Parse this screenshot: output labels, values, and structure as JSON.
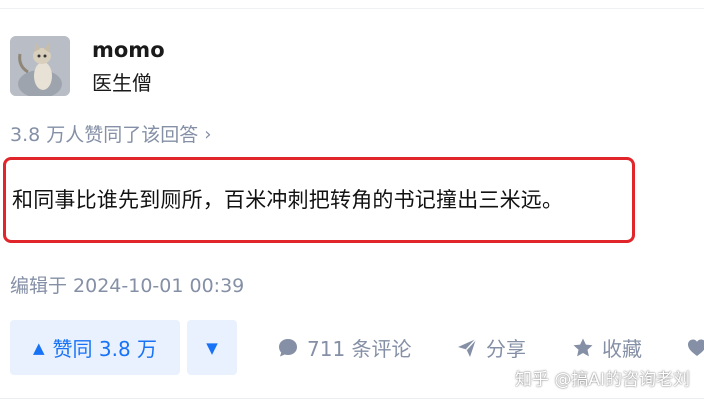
{
  "author": {
    "name": "momo",
    "tag": "医生僧"
  },
  "endorsed": {
    "text": "3.8 万人赞同了该回答",
    "chevron": "›"
  },
  "answer": {
    "text": "和同事比谁先到厕所，百米冲刺把转角的书记撞出三米远。"
  },
  "edit_time": "编辑于 2024-10-01 00:39",
  "actions": {
    "vote_up_label": "赞同 3.8 万",
    "vote_up_icon": "▲",
    "vote_down_icon": "▼",
    "comment_label": "711 条评论",
    "share_label": "分享",
    "favorite_label": "收藏"
  },
  "watermark": "知乎 @搞AI的咨询老刘",
  "colors": {
    "accent": "#1772f6",
    "accent_bg": "#e8f1fd",
    "muted": "#8590a6",
    "highlight_border": "#e0262a"
  },
  "icons": {
    "avatar": "cat-photo",
    "comment": "speech-bubble-icon",
    "share": "paper-plane-icon",
    "favorite": "star-icon",
    "like": "heart-icon"
  }
}
